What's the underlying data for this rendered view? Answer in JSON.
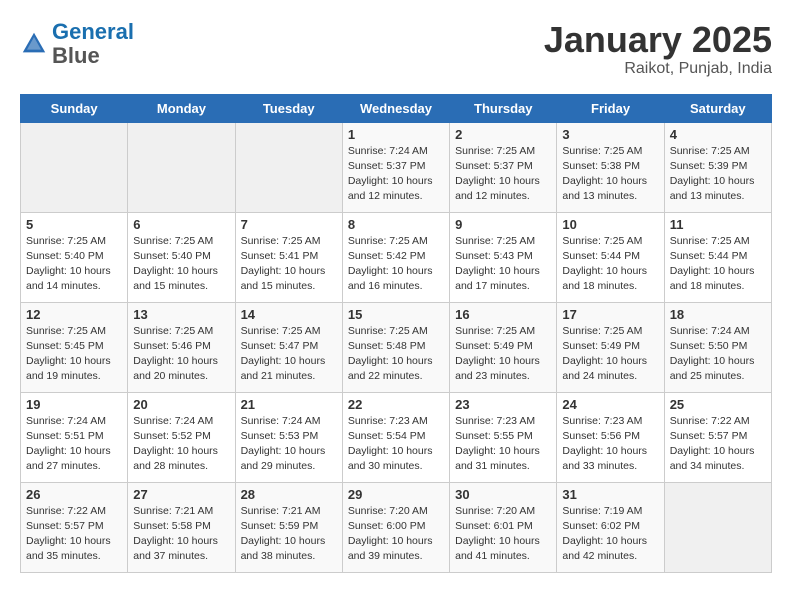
{
  "header": {
    "logo_line1": "General",
    "logo_line2": "Blue",
    "month": "January 2025",
    "location": "Raikot, Punjab, India"
  },
  "weekdays": [
    "Sunday",
    "Monday",
    "Tuesday",
    "Wednesday",
    "Thursday",
    "Friday",
    "Saturday"
  ],
  "weeks": [
    [
      {
        "day": "",
        "info": ""
      },
      {
        "day": "",
        "info": ""
      },
      {
        "day": "",
        "info": ""
      },
      {
        "day": "1",
        "info": "Sunrise: 7:24 AM\nSunset: 5:37 PM\nDaylight: 10 hours\nand 12 minutes."
      },
      {
        "day": "2",
        "info": "Sunrise: 7:25 AM\nSunset: 5:37 PM\nDaylight: 10 hours\nand 12 minutes."
      },
      {
        "day": "3",
        "info": "Sunrise: 7:25 AM\nSunset: 5:38 PM\nDaylight: 10 hours\nand 13 minutes."
      },
      {
        "day": "4",
        "info": "Sunrise: 7:25 AM\nSunset: 5:39 PM\nDaylight: 10 hours\nand 13 minutes."
      }
    ],
    [
      {
        "day": "5",
        "info": "Sunrise: 7:25 AM\nSunset: 5:40 PM\nDaylight: 10 hours\nand 14 minutes."
      },
      {
        "day": "6",
        "info": "Sunrise: 7:25 AM\nSunset: 5:40 PM\nDaylight: 10 hours\nand 15 minutes."
      },
      {
        "day": "7",
        "info": "Sunrise: 7:25 AM\nSunset: 5:41 PM\nDaylight: 10 hours\nand 15 minutes."
      },
      {
        "day": "8",
        "info": "Sunrise: 7:25 AM\nSunset: 5:42 PM\nDaylight: 10 hours\nand 16 minutes."
      },
      {
        "day": "9",
        "info": "Sunrise: 7:25 AM\nSunset: 5:43 PM\nDaylight: 10 hours\nand 17 minutes."
      },
      {
        "day": "10",
        "info": "Sunrise: 7:25 AM\nSunset: 5:44 PM\nDaylight: 10 hours\nand 18 minutes."
      },
      {
        "day": "11",
        "info": "Sunrise: 7:25 AM\nSunset: 5:44 PM\nDaylight: 10 hours\nand 18 minutes."
      }
    ],
    [
      {
        "day": "12",
        "info": "Sunrise: 7:25 AM\nSunset: 5:45 PM\nDaylight: 10 hours\nand 19 minutes."
      },
      {
        "day": "13",
        "info": "Sunrise: 7:25 AM\nSunset: 5:46 PM\nDaylight: 10 hours\nand 20 minutes."
      },
      {
        "day": "14",
        "info": "Sunrise: 7:25 AM\nSunset: 5:47 PM\nDaylight: 10 hours\nand 21 minutes."
      },
      {
        "day": "15",
        "info": "Sunrise: 7:25 AM\nSunset: 5:48 PM\nDaylight: 10 hours\nand 22 minutes."
      },
      {
        "day": "16",
        "info": "Sunrise: 7:25 AM\nSunset: 5:49 PM\nDaylight: 10 hours\nand 23 minutes."
      },
      {
        "day": "17",
        "info": "Sunrise: 7:25 AM\nSunset: 5:49 PM\nDaylight: 10 hours\nand 24 minutes."
      },
      {
        "day": "18",
        "info": "Sunrise: 7:24 AM\nSunset: 5:50 PM\nDaylight: 10 hours\nand 25 minutes."
      }
    ],
    [
      {
        "day": "19",
        "info": "Sunrise: 7:24 AM\nSunset: 5:51 PM\nDaylight: 10 hours\nand 27 minutes."
      },
      {
        "day": "20",
        "info": "Sunrise: 7:24 AM\nSunset: 5:52 PM\nDaylight: 10 hours\nand 28 minutes."
      },
      {
        "day": "21",
        "info": "Sunrise: 7:24 AM\nSunset: 5:53 PM\nDaylight: 10 hours\nand 29 minutes."
      },
      {
        "day": "22",
        "info": "Sunrise: 7:23 AM\nSunset: 5:54 PM\nDaylight: 10 hours\nand 30 minutes."
      },
      {
        "day": "23",
        "info": "Sunrise: 7:23 AM\nSunset: 5:55 PM\nDaylight: 10 hours\nand 31 minutes."
      },
      {
        "day": "24",
        "info": "Sunrise: 7:23 AM\nSunset: 5:56 PM\nDaylight: 10 hours\nand 33 minutes."
      },
      {
        "day": "25",
        "info": "Sunrise: 7:22 AM\nSunset: 5:57 PM\nDaylight: 10 hours\nand 34 minutes."
      }
    ],
    [
      {
        "day": "26",
        "info": "Sunrise: 7:22 AM\nSunset: 5:57 PM\nDaylight: 10 hours\nand 35 minutes."
      },
      {
        "day": "27",
        "info": "Sunrise: 7:21 AM\nSunset: 5:58 PM\nDaylight: 10 hours\nand 37 minutes."
      },
      {
        "day": "28",
        "info": "Sunrise: 7:21 AM\nSunset: 5:59 PM\nDaylight: 10 hours\nand 38 minutes."
      },
      {
        "day": "29",
        "info": "Sunrise: 7:20 AM\nSunset: 6:00 PM\nDaylight: 10 hours\nand 39 minutes."
      },
      {
        "day": "30",
        "info": "Sunrise: 7:20 AM\nSunset: 6:01 PM\nDaylight: 10 hours\nand 41 minutes."
      },
      {
        "day": "31",
        "info": "Sunrise: 7:19 AM\nSunset: 6:02 PM\nDaylight: 10 hours\nand 42 minutes."
      },
      {
        "day": "",
        "info": ""
      }
    ]
  ]
}
